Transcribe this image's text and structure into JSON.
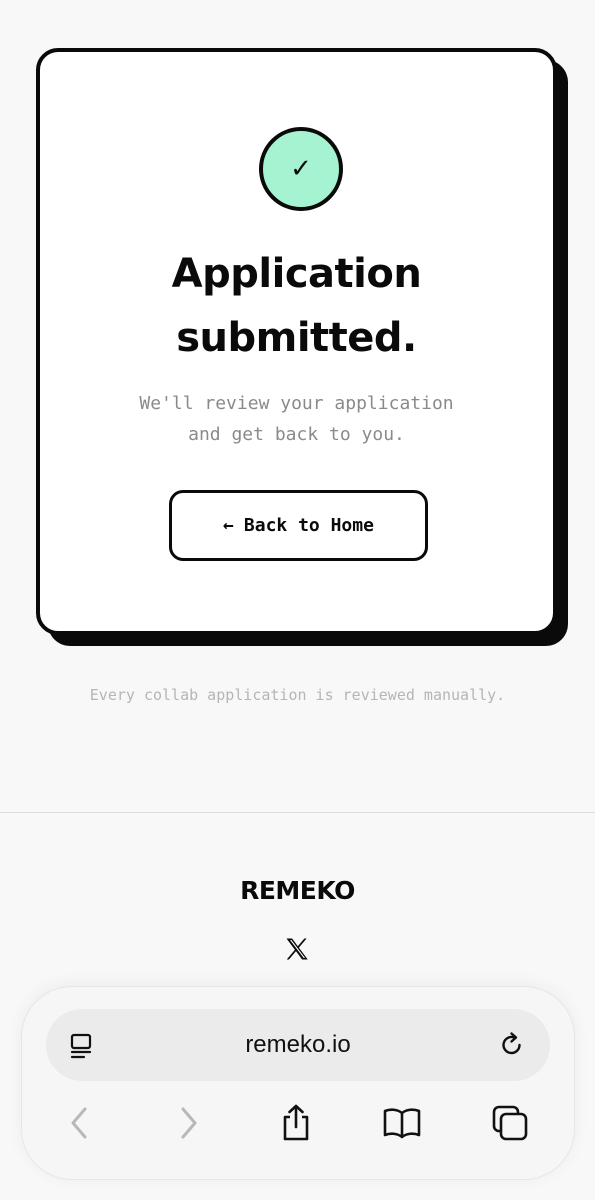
{
  "card": {
    "check_glyph": "✓",
    "title_line1": "Application",
    "title_line2": "submitted.",
    "subtitle_line1": "We'll review your application",
    "subtitle_line2": "and get back to you.",
    "back_button_arrow": "←",
    "back_button_label": "Back to Home",
    "accent_color": "#a5f3d0"
  },
  "note": "Every collab application is reviewed manually.",
  "footer": {
    "logo": "REMEKO",
    "social_icon": "x-logo-icon"
  },
  "browser": {
    "url": "remeko.io",
    "icons": [
      "reader-icon",
      "reload-icon",
      "back-icon",
      "forward-icon",
      "share-icon",
      "bookmarks-icon",
      "tabs-icon"
    ]
  }
}
